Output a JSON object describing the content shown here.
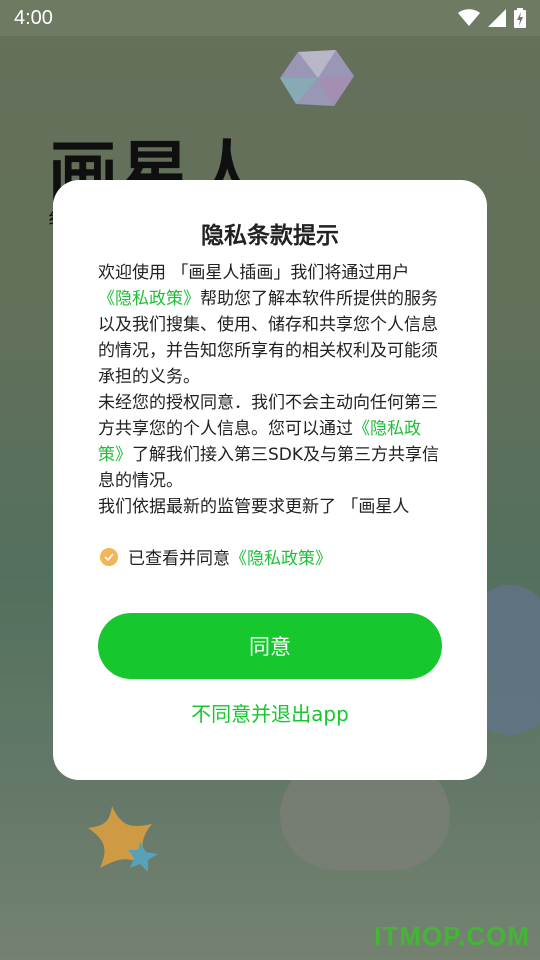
{
  "statusbar": {
    "time": "4:00",
    "icons": [
      "wifi-icon",
      "signal-icon",
      "battery-charging-icon"
    ]
  },
  "background": {
    "app_title": "画星人",
    "subtitle_fragment": "纟",
    "watermark": "ITMOP.COM"
  },
  "dialog": {
    "title": "隐私条款提示",
    "body": {
      "p1_pre": "欢迎使用 「画星人插画」我们将通过用户",
      "p1_link": "《隐私政策》",
      "p1_post": "帮助您了解本软件所提供的服务以及我们搜集、使用、储存和共享您个人信息的情况，并告知您所享有的相关权利及可能须承担的义务。",
      "p2_pre": " 未经您的授权同意．我们不会主动向任何第三方共享您的个人信息。您可以通过",
      "p2_link": "《隐私政策》",
      "p2_post": "了解我们接入第三SDK及与第三方共享信息的情况。",
      "p3": " 我们依据最新的监管要求更新了 「画星人"
    },
    "agree_row": {
      "text": "已查看并同意",
      "link": "《隐私政策》",
      "checked": true
    },
    "agree_button": "同意",
    "disagree_link": "不同意并退出app"
  },
  "colors": {
    "accent": "#16c72e",
    "link": "#1fbf3a",
    "checkbox": "#f2b55a"
  }
}
